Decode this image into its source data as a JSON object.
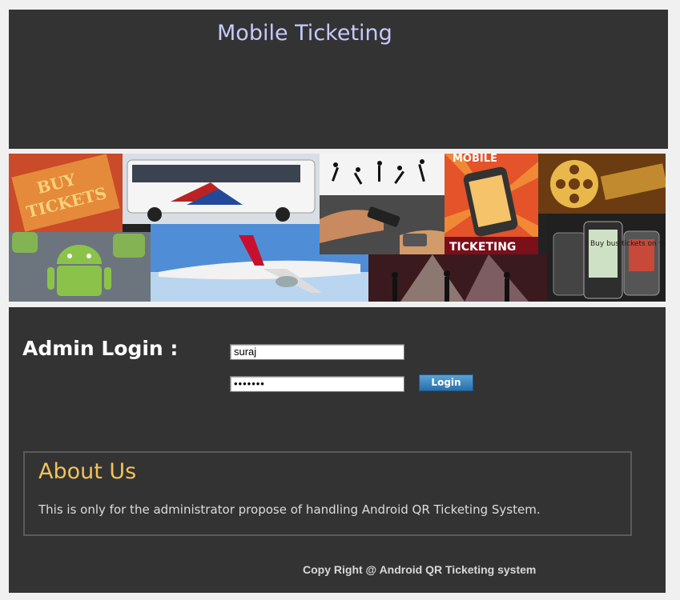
{
  "header": {
    "title": "Mobile Ticketing"
  },
  "banner": {
    "tiles": [
      {
        "name": "buy-tickets",
        "text_line1": "BUY",
        "text_line2": "TICKETS"
      },
      {
        "name": "bus"
      },
      {
        "name": "dancers"
      },
      {
        "name": "mobile-ticketing",
        "text_top": "MOBILE",
        "text_bottom": "TICKETING"
      },
      {
        "name": "film-reel"
      },
      {
        "name": "android"
      },
      {
        "name": "airplane"
      },
      {
        "name": "hand-scanner"
      },
      {
        "name": "concert"
      },
      {
        "name": "phones",
        "text": "Buy bus tickets on your mobile"
      }
    ]
  },
  "login": {
    "label": "Admin Login :",
    "username_value": "suraj",
    "password_value": "•••••••",
    "button_label": "Login"
  },
  "about": {
    "title": "About Us",
    "text": "This is only for the administrator propose of handling Android QR Ticketing System."
  },
  "footer": {
    "copyright": "Copy Right @ Android QR Ticketing system"
  },
  "colors": {
    "panel_bg": "#333333",
    "page_bg": "#f0f0f0",
    "title_color": "#c8c8ff",
    "about_title_color": "#f2c25a",
    "button_color": "#2a6fa8"
  }
}
